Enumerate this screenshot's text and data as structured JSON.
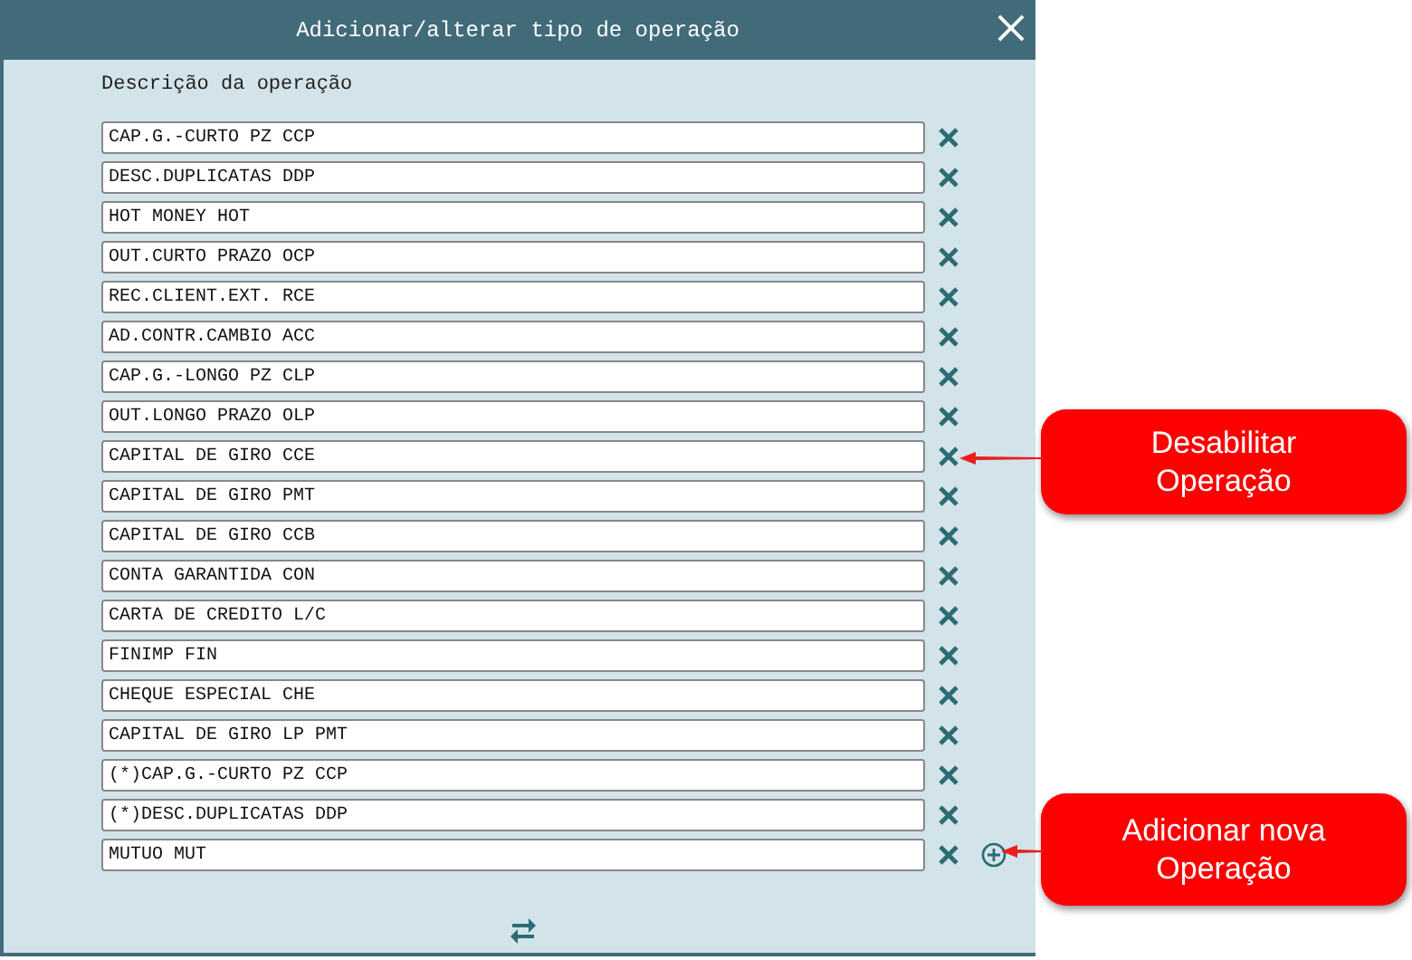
{
  "window": {
    "title": "Adicionar/alterar tipo de operação"
  },
  "field_label": "Descrição da operação",
  "operations": [
    {
      "value": "CAP.G.-CURTO PZ CCP",
      "last": false
    },
    {
      "value": "DESC.DUPLICATAS DDP",
      "last": false
    },
    {
      "value": "HOT MONEY HOT",
      "last": false
    },
    {
      "value": "OUT.CURTO PRAZO OCP",
      "last": false
    },
    {
      "value": "REC.CLIENT.EXT. RCE",
      "last": false
    },
    {
      "value": "AD.CONTR.CAMBIO ACC",
      "last": false
    },
    {
      "value": "CAP.G.-LONGO PZ CLP",
      "last": false
    },
    {
      "value": "OUT.LONGO PRAZO OLP",
      "last": false
    },
    {
      "value": "CAPITAL DE GIRO CCE",
      "last": false
    },
    {
      "value": "CAPITAL DE GIRO PMT",
      "last": false
    },
    {
      "value": "CAPITAL DE GIRO CCB",
      "last": false
    },
    {
      "value": "CONTA GARANTIDA CON",
      "last": false
    },
    {
      "value": "CARTA DE CREDITO L/C",
      "last": false
    },
    {
      "value": "FINIMP FIN",
      "last": false
    },
    {
      "value": "CHEQUE ESPECIAL CHE",
      "last": false
    },
    {
      "value": "CAPITAL DE GIRO LP PMT",
      "last": false
    },
    {
      "value": "(*)CAP.G.-CURTO PZ CCP",
      "last": false
    },
    {
      "value": "(*)DESC.DUPLICATAS DDP",
      "last": false
    },
    {
      "value": "MUTUO MUT",
      "last": true
    }
  ],
  "callouts": [
    {
      "text": "Desabilitar Operação"
    },
    {
      "text": "Adicionar nova Operação"
    }
  ]
}
